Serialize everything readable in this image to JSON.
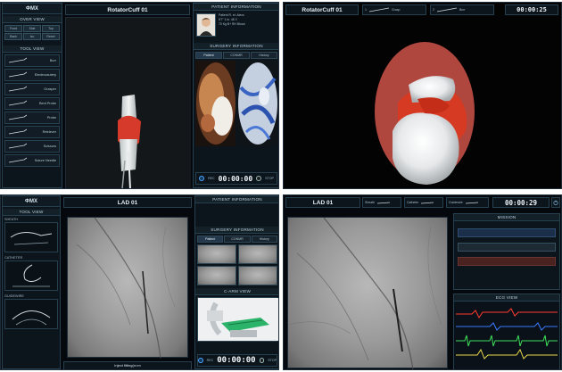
{
  "top_left": {
    "logo": "ΦMX",
    "overview_header": "OVER VIEW",
    "view_buttons": [
      "Front",
      "Side",
      "Top",
      "Back",
      "Iso",
      "Reset"
    ],
    "tool_view_header": "TOOL VIEW",
    "tools": [
      {
        "label": "Burr",
        "icon": "burr-tool-icon"
      },
      {
        "label": "Electrocautery",
        "icon": "electrocautery-tool-icon"
      },
      {
        "label": "Grasper",
        "icon": "grasper-tool-icon"
      },
      {
        "label": "Bent Probe",
        "icon": "bent-probe-icon"
      },
      {
        "label": "Probe",
        "icon": "probe-icon"
      },
      {
        "label": "Retriever",
        "icon": "retriever-icon"
      },
      {
        "label": "Scissors",
        "icon": "scissors-icon"
      },
      {
        "label": "Suture Needle",
        "icon": "suture-needle-icon"
      }
    ],
    "title": "RotatorCuff 01",
    "patient_header": "PATIENT INFORMATION",
    "patient_lines": [
      "Patient R. et. Alexs",
      "5'7\" 1 in.    48 Y.",
      "70 Kg     B+ RH Blood"
    ],
    "surgery_header": "SURGERY INFORMATION",
    "surgery_tabs": [
      "Patient",
      "CONMR",
      "History"
    ],
    "rec_label": "REC",
    "timer": "00:00:00",
    "stop_label": "STOP"
  },
  "top_right": {
    "title": "RotatorCuff 01",
    "tool_slots": [
      {
        "index": "1",
        "name": "Grasp"
      },
      {
        "index": "2",
        "name": "Burr"
      }
    ],
    "timer": "00:00:25"
  },
  "bottom_left": {
    "logo": "ΦMX",
    "tool_view_header": "TOOL VIEW",
    "sections": [
      "SHEATH",
      "CATHETER",
      "GUIDEWIRE"
    ],
    "title": "LAD 01",
    "patient_header": "PATIENT INFORMATION",
    "surgery_header": "SURGERY INFORMATION",
    "surgery_tabs": [
      "Patient",
      "CONMR",
      "History"
    ],
    "carm_header": "C-ARM VIEW",
    "instruction": "Inject fitting(n=m",
    "rec_label": "REC",
    "timer": "00:00:00",
    "stop_label": "STOP"
  },
  "bottom_right": {
    "title": "LAD 01",
    "slots": [
      "Sheath",
      "Catheter",
      "Guidewire"
    ],
    "timer": "00:00:29",
    "mission_header": "MISSION",
    "ecg_header": "ECG VIEW"
  },
  "colors": {
    "panel_bg": "#0d151c",
    "accent_blue": "#4da3ff",
    "tissue_red": "#b0473f",
    "ecg_red": "#ff3b2f",
    "ecg_blue": "#3a7bff",
    "ecg_green": "#3fe05a",
    "ecg_yellow": "#e8d84a"
  }
}
